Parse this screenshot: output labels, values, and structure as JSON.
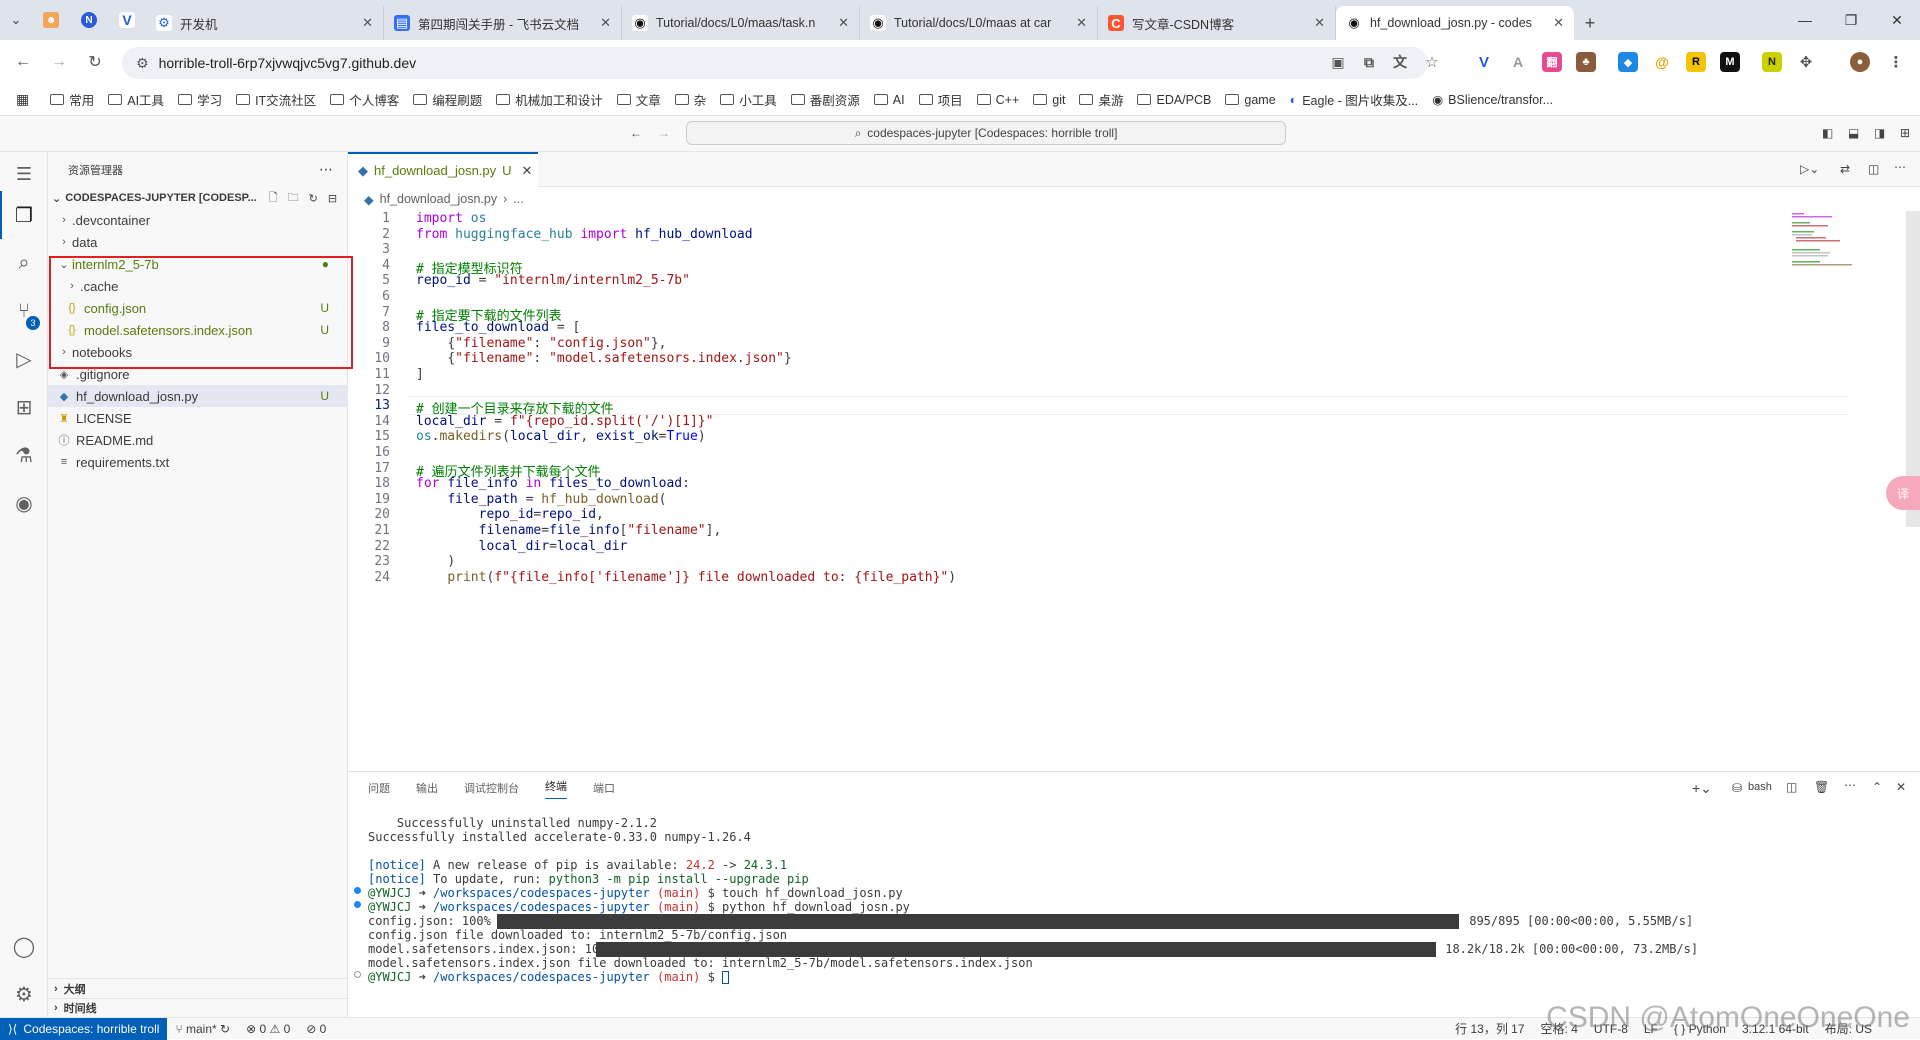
{
  "browser": {
    "tabs": [
      {
        "title": "开发机",
        "active": false
      },
      {
        "title": "第四期闯关手册 - 飞书云文档",
        "active": false
      },
      {
        "title": "Tutorial/docs/L0/maas/task.n",
        "active": false
      },
      {
        "title": "Tutorial/docs/L0/maas at car",
        "active": false
      },
      {
        "title": "写文章-CSDN博客",
        "active": false
      },
      {
        "title": "hf_download_josn.py - codes",
        "active": true
      }
    ],
    "url": "horrible-troll-6rp7xjvwqjvc5vg7.github.dev",
    "bookmarks": [
      "常用",
      "AI工具",
      "学习",
      "IT交流社区",
      "个人博客",
      "编程刷题",
      "机械加工和设计",
      "文章",
      "杂",
      "小工具",
      "番剧资源",
      "AI",
      "项目",
      "C++",
      "git",
      "桌游",
      "EDA/PCB",
      "game",
      "Eagle - 图片收集及...",
      "BSlience/transfor..."
    ]
  },
  "vscode": {
    "command_center": "codespaces-jupyter [Codespaces: horrible troll]",
    "explorer_title": "资源管理器",
    "workspace": "CODESPACES-JUPYTER [CODESP...",
    "tree": [
      {
        "label": ".devcontainer",
        "type": "folder",
        "depth": 1,
        "open": false
      },
      {
        "label": "data",
        "type": "folder",
        "depth": 1,
        "open": false
      },
      {
        "label": "internlm2_5-7b",
        "type": "folder",
        "depth": 1,
        "open": true,
        "badge": "●",
        "green": true
      },
      {
        "label": ".cache",
        "type": "folder",
        "depth": 2,
        "open": false
      },
      {
        "label": "config.json",
        "type": "json",
        "depth": 2,
        "badge": "U",
        "green": true
      },
      {
        "label": "model.safetensors.index.json",
        "type": "json",
        "depth": 2,
        "badge": "U",
        "green": true
      },
      {
        "label": "notebooks",
        "type": "folder",
        "depth": 1,
        "open": false
      },
      {
        "label": ".gitignore",
        "type": "git",
        "depth": 1
      },
      {
        "label": "hf_download_josn.py",
        "type": "py",
        "depth": 1,
        "badge": "U",
        "selected": true
      },
      {
        "label": "LICENSE",
        "type": "license",
        "depth": 1
      },
      {
        "label": "README.md",
        "type": "info",
        "depth": 1
      },
      {
        "label": "requirements.txt",
        "type": "txt",
        "depth": 1
      }
    ],
    "outline_label": "大纲",
    "timeline_label": "时间线",
    "editor_tab": {
      "name": "hf_download_josn.py",
      "badge": "U"
    },
    "breadcrumb": [
      "hf_download_josn.py",
      "..."
    ],
    "current_line": 13,
    "code": [
      "import os",
      "from huggingface_hub import hf_hub_download",
      "",
      "# 指定模型标识符",
      "repo_id = \"internlm/internlm2_5-7b\"",
      "",
      "# 指定要下载的文件列表",
      "files_to_download = [",
      "    {\"filename\": \"config.json\"},",
      "    {\"filename\": \"model.safetensors.index.json\"}",
      "]",
      "",
      "# 创建一个目录来存放下载的文件",
      "local_dir = f\"{repo_id.split('/')[1]}\"",
      "os.makedirs(local_dir, exist_ok=True)",
      "",
      "# 遍历文件列表并下载每个文件",
      "for file_info in files_to_download:",
      "    file_path = hf_hub_download(",
      "        repo_id=repo_id,",
      "        filename=file_info[\"filename\"],",
      "        local_dir=local_dir",
      "    )",
      "    print(f\"{file_info['filename']} file downloaded to: {file_path}\")"
    ],
    "panel_tabs": [
      "问题",
      "输出",
      "调试控制台",
      "终端",
      "端口"
    ],
    "active_panel_tab": "终端",
    "terminal_shell": "bash",
    "terminal": {
      "l1": "    Successfully uninstalled numpy-2.1.2",
      "l2": "Successfully installed accelerate-0.33.0 numpy-1.26.4",
      "notice": "[notice]",
      "n1_text": " A new release of pip is available: ",
      "n1_old": "24.2",
      "n1_arrow": " -> ",
      "n1_new": "24.3.1",
      "n2_text": " To update, run: ",
      "n2_cmd": "python3 -m pip install --upgrade pip",
      "user": "@YWJCJ",
      "arrow": " ➜ ",
      "path": "/workspaces/codespaces-jupyter",
      "branch": " (main)",
      "cmd1": " $ touch hf_download_josn.py",
      "cmd2": " $ python hf_download_josn.py",
      "p1_label": "config.json: 100%",
      "p1_stats": " 895/895 [00:00<00:00, 5.55MB/s]",
      "p1_done": "config.json file downloaded to: internlm2_5-7b/config.json",
      "p2_label": "model.safetensors.index.json: 100%",
      "p2_stats": " 18.2k/18.2k [00:00<00:00, 73.2MB/s]",
      "p2_done": "model.safetensors.index.json file downloaded to: internlm2_5-7b/model.safetensors.index.json",
      "cmd3": " $ "
    },
    "status": {
      "remote": "Codespaces: horrible troll",
      "branch": "main*",
      "errors": "⊗ 0 ⚠ 0",
      "ports": "⊘ 0",
      "position": "行 13，列 17",
      "spaces": "空格: 4",
      "encoding": "UTF-8",
      "eol": "LF",
      "language": "Python",
      "version": "3.12.1 64-bit",
      "layout": "布局: US"
    },
    "activity_badge": "3"
  },
  "watermark": "CSDN @AtomOneOneOne",
  "colors": {
    "accent": "#005fb8",
    "added": "#587c0c",
    "highlight_box": "#e02020"
  }
}
